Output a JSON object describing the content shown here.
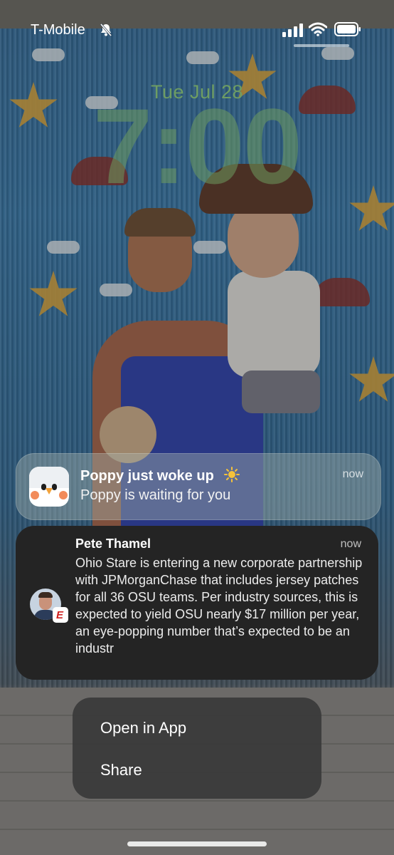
{
  "status_bar": {
    "carrier": "T-Mobile",
    "icons": [
      "bell-slash-icon",
      "cellular-signal-icon",
      "wifi-icon",
      "battery-icon"
    ]
  },
  "lock_screen": {
    "date": "Tue Jul 28",
    "time": "7:00"
  },
  "notifications": [
    {
      "app_icon": "poppy-app-icon",
      "title": "Poppy just woke up",
      "title_emoji_icon": "sun-icon",
      "body": "Poppy is waiting for you",
      "time": "now"
    },
    {
      "app_icon": "espn-badge-icon",
      "title": "Pete Thamel",
      "body": "Ohio Stare is entering a new corporate partnership with JPMorganChase that includes jersey patches for all 36 OSU teams. Per industry sources, this is expected to yield OSU nearly $17 million per year, an eye-popping number that’s expected to be an industr",
      "time": "now",
      "badge_letter": "E"
    }
  ],
  "context_menu": {
    "items": [
      {
        "label": "Open in App"
      },
      {
        "label": "Share"
      }
    ]
  },
  "colors": {
    "date_accent": "#8fd57f",
    "notification_dark": "#242424",
    "espn_red": "#d0201f"
  }
}
